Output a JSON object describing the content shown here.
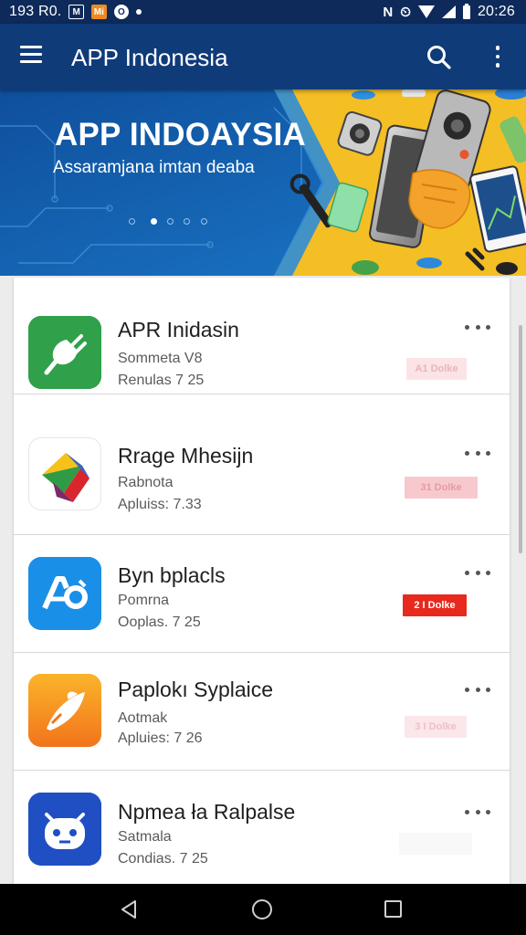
{
  "status_bar": {
    "carrier_text": "193 R0.",
    "notification_icons": [
      "mail-icon",
      "mi-icon",
      "target-icon",
      "location-dot-icon"
    ],
    "icon_labels": {
      "mail": "M",
      "mi": "Mi",
      "target": "O"
    },
    "nfc": "N",
    "alarm": "⏲",
    "time": "20:26"
  },
  "app_bar": {
    "title": "APP Indonesia",
    "icons": [
      "menu-icon",
      "search-icon",
      "more-vert-icon"
    ]
  },
  "banner": {
    "title": "APP INDOAYSIA",
    "subtitle": "Assaramjana imtan deaba",
    "carousel_active_index": 1,
    "carousel_count": 5
  },
  "apps": [
    {
      "name": "APR Inidasin",
      "line1": "Sommeta V8",
      "line2": "Renulas 7 25",
      "badge": "A1 Dolke",
      "badge_style": "faint",
      "icon": "plug-icon",
      "icon_color": "#2e9a45"
    },
    {
      "name": "Rrage Mhesijn",
      "line1": "Rabnota",
      "line2": "Apluiss: 7.33",
      "badge": "31 Dolke",
      "badge_style": "light",
      "icon": "colorful-gem-icon",
      "icon_color": "#ffffff"
    },
    {
      "name": "Byn bplacls",
      "line1": "Pomrna",
      "line2": "Ooplas. 7 25",
      "badge": "2 I Dolke",
      "badge_style": "solid",
      "icon": "ab-logo-icon",
      "icon_color": "#1a8fe8"
    },
    {
      "name": "Paplokı Syplaice",
      "line1": "Aotmak",
      "line2": "Apluies: 7 26",
      "badge": "3 I Dolke",
      "badge_style": "faint",
      "icon": "rocket-icon",
      "icon_color": "#f79b1e"
    },
    {
      "name": "Npmea ła Ralpalse",
      "line1": "Satmala",
      "line2": "Condias. 7 25",
      "badge": "",
      "badge_style": "faint",
      "icon": "robot-face-icon",
      "icon_color": "#1f4fc2"
    }
  ],
  "colors": {
    "app_bar": "#103b79",
    "status_bar": "#0d2a5a",
    "banner_blue": "#1568b9",
    "banner_yellow": "#f4be25",
    "badge_red": "#e8291d"
  },
  "nav_bar": {
    "icons": [
      "back-icon",
      "home-icon",
      "recents-icon"
    ]
  }
}
